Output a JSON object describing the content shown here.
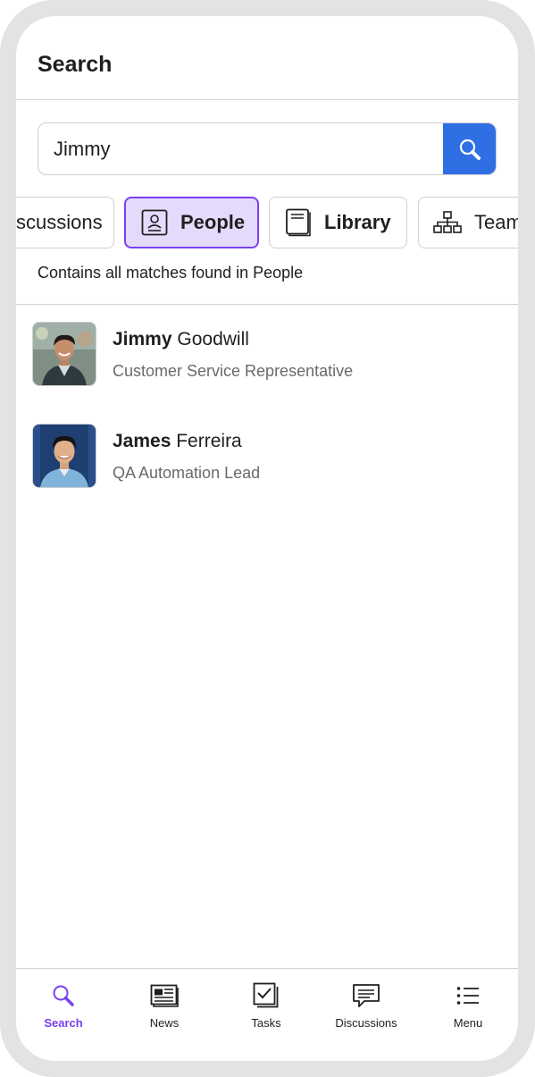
{
  "header": {
    "title": "Search"
  },
  "search": {
    "value": "Jimmy",
    "button_icon": "search-icon"
  },
  "filters": {
    "chips": [
      {
        "label": "Discussions",
        "visible_label": "scussions",
        "icon": null,
        "active": false
      },
      {
        "label": "People",
        "icon": "person-card-icon",
        "active": true
      },
      {
        "label": "Library",
        "icon": "book-icon",
        "active": false
      },
      {
        "label": "Team",
        "icon": "org-chart-icon",
        "active": false
      }
    ],
    "description": "Contains all matches found in People"
  },
  "results": [
    {
      "name_match": "Jimmy",
      "name_rest": " Goodwill",
      "title": "Customer Service Representative"
    },
    {
      "name_match": "James",
      "name_rest": " Ferreira",
      "title": "QA Automation Lead"
    }
  ],
  "tabbar": {
    "tabs": [
      {
        "label": "Search",
        "icon": "search-icon",
        "active": true
      },
      {
        "label": "News",
        "icon": "newspaper-icon",
        "active": false
      },
      {
        "label": "Tasks",
        "icon": "tasks-checkbox-icon",
        "active": false
      },
      {
        "label": "Discussions",
        "icon": "chat-bubble-icon",
        "active": false
      },
      {
        "label": "Menu",
        "icon": "list-menu-icon",
        "active": false
      }
    ]
  },
  "colors": {
    "accent": "#7a3ff0",
    "accent_light": "#e4dafc",
    "search_button": "#2f6fe4",
    "frame": "#e3e3e3"
  }
}
